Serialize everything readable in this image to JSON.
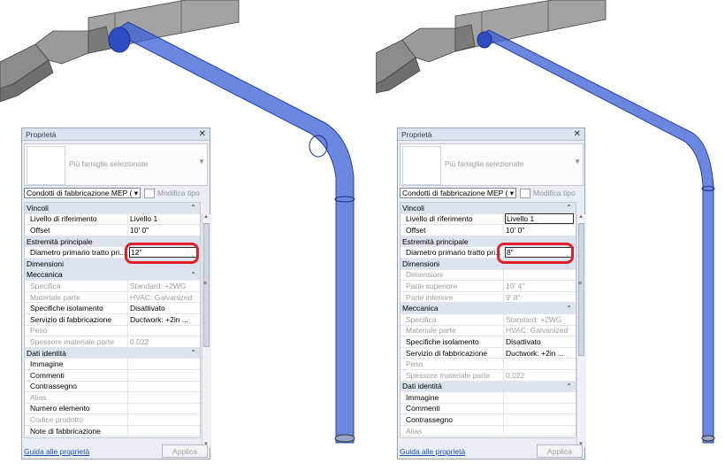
{
  "left": {
    "palette_title": "Proprietà",
    "close_glyph": "✕",
    "type_name": "Più famiglie selezionate",
    "selector": "Condotti di fabbricazione MEP (",
    "edit_type": "Modifica tipo",
    "rows": [
      {
        "kind": "section",
        "label": "Vincoli",
        "caret": "⌃"
      },
      {
        "kind": "prop",
        "name": "Livello di riferimento",
        "value": "Livello 1"
      },
      {
        "kind": "prop",
        "name": "Offset",
        "value": "10'  0\""
      },
      {
        "kind": "section",
        "label": "Estremità principale",
        "caret": ""
      },
      {
        "kind": "prop",
        "name": "Diametro primario tratto pri...",
        "value": "12\"",
        "boxed": true
      },
      {
        "kind": "section",
        "label": "Dimensioni",
        "caret": ""
      },
      {
        "kind": "section",
        "label": "Meccanica",
        "caret": "⌃"
      },
      {
        "kind": "prop",
        "name": "Specifica",
        "value": "Standard: +2WG",
        "dim": true
      },
      {
        "kind": "prop",
        "name": "Materiale parte",
        "value": "HVAC: Galvanized",
        "dim": true
      },
      {
        "kind": "prop",
        "name": "Specifiche isolamento",
        "value": "Disattivato"
      },
      {
        "kind": "prop",
        "name": "Servizio di fabbricazione",
        "value": "Ductwork: +2in ..."
      },
      {
        "kind": "prop",
        "name": "Peso",
        "value": "",
        "dim": true
      },
      {
        "kind": "prop",
        "name": "Spessore materiale parte",
        "value": "0.022",
        "dim": true
      },
      {
        "kind": "section",
        "label": "Dati identità",
        "caret": "⌃"
      },
      {
        "kind": "prop",
        "name": "Immagine",
        "value": ""
      },
      {
        "kind": "prop",
        "name": "Commenti",
        "value": ""
      },
      {
        "kind": "prop",
        "name": "Contrassegno",
        "value": ""
      },
      {
        "kind": "prop",
        "name": "Alias",
        "value": "",
        "dim": true
      },
      {
        "kind": "prop",
        "name": "Numero elemento",
        "value": ""
      },
      {
        "kind": "prop",
        "name": "Codice prodotto",
        "value": "",
        "dim": true
      },
      {
        "kind": "prop",
        "name": "Note di fabbricazione",
        "value": ""
      }
    ],
    "help_link": "Guida alle proprietà",
    "apply_button": "Applica"
  },
  "right": {
    "palette_title": "Proprietà",
    "close_glyph": "✕",
    "type_name": "Più famiglie selezionate",
    "selector": "Condotti di fabbricazione MEP (",
    "edit_type": "Modifica tipo",
    "rows": [
      {
        "kind": "section",
        "label": "Vincoli",
        "caret": "⌃"
      },
      {
        "kind": "prop",
        "name": "Livello di riferimento",
        "value": "Livello 1",
        "boxed": true
      },
      {
        "kind": "prop",
        "name": "Offset",
        "value": "10'  0\""
      },
      {
        "kind": "section",
        "label": "Estremità principale",
        "caret": ""
      },
      {
        "kind": "prop",
        "name": "Diametro primario tratto pri...",
        "value": "8\"",
        "boxed": true
      },
      {
        "kind": "section",
        "label": "Dimensioni",
        "caret": "⌃"
      },
      {
        "kind": "prop",
        "name": "Dimensioni",
        "value": "",
        "dim": true
      },
      {
        "kind": "prop",
        "name": "Parte superiore",
        "value": "10'  4\"",
        "dim": true
      },
      {
        "kind": "prop",
        "name": "Parte inferiore",
        "value": "9'  8\"",
        "dim": true
      },
      {
        "kind": "section",
        "label": "Meccanica",
        "caret": "⌃"
      },
      {
        "kind": "prop",
        "name": "Specifica",
        "value": "Standard: +2WG",
        "dim": true
      },
      {
        "kind": "prop",
        "name": "Materiale parte",
        "value": "HVAC: Galvanized",
        "dim": true
      },
      {
        "kind": "prop",
        "name": "Specifiche isolamento",
        "value": "Disattivato"
      },
      {
        "kind": "prop",
        "name": "Servizio di fabbricazione",
        "value": "Ductwork: +2in ..."
      },
      {
        "kind": "prop",
        "name": "Peso",
        "value": "",
        "dim": true
      },
      {
        "kind": "prop",
        "name": "Spessore materiale parte",
        "value": "0.022",
        "dim": true
      },
      {
        "kind": "section",
        "label": "Dati identità",
        "caret": "⌃"
      },
      {
        "kind": "prop",
        "name": "Immagine",
        "value": ""
      },
      {
        "kind": "prop",
        "name": "Commenti",
        "value": ""
      },
      {
        "kind": "prop",
        "name": "Contrassegno",
        "value": ""
      },
      {
        "kind": "prop",
        "name": "Alias",
        "value": "",
        "dim": true
      }
    ],
    "help_link": "Guida alle proprietà",
    "apply_button": "Applica"
  },
  "colors": {
    "duct_selected": "#3b5fd6",
    "duct_gray": "#8a8a8a",
    "highlight": "#e0202a"
  }
}
